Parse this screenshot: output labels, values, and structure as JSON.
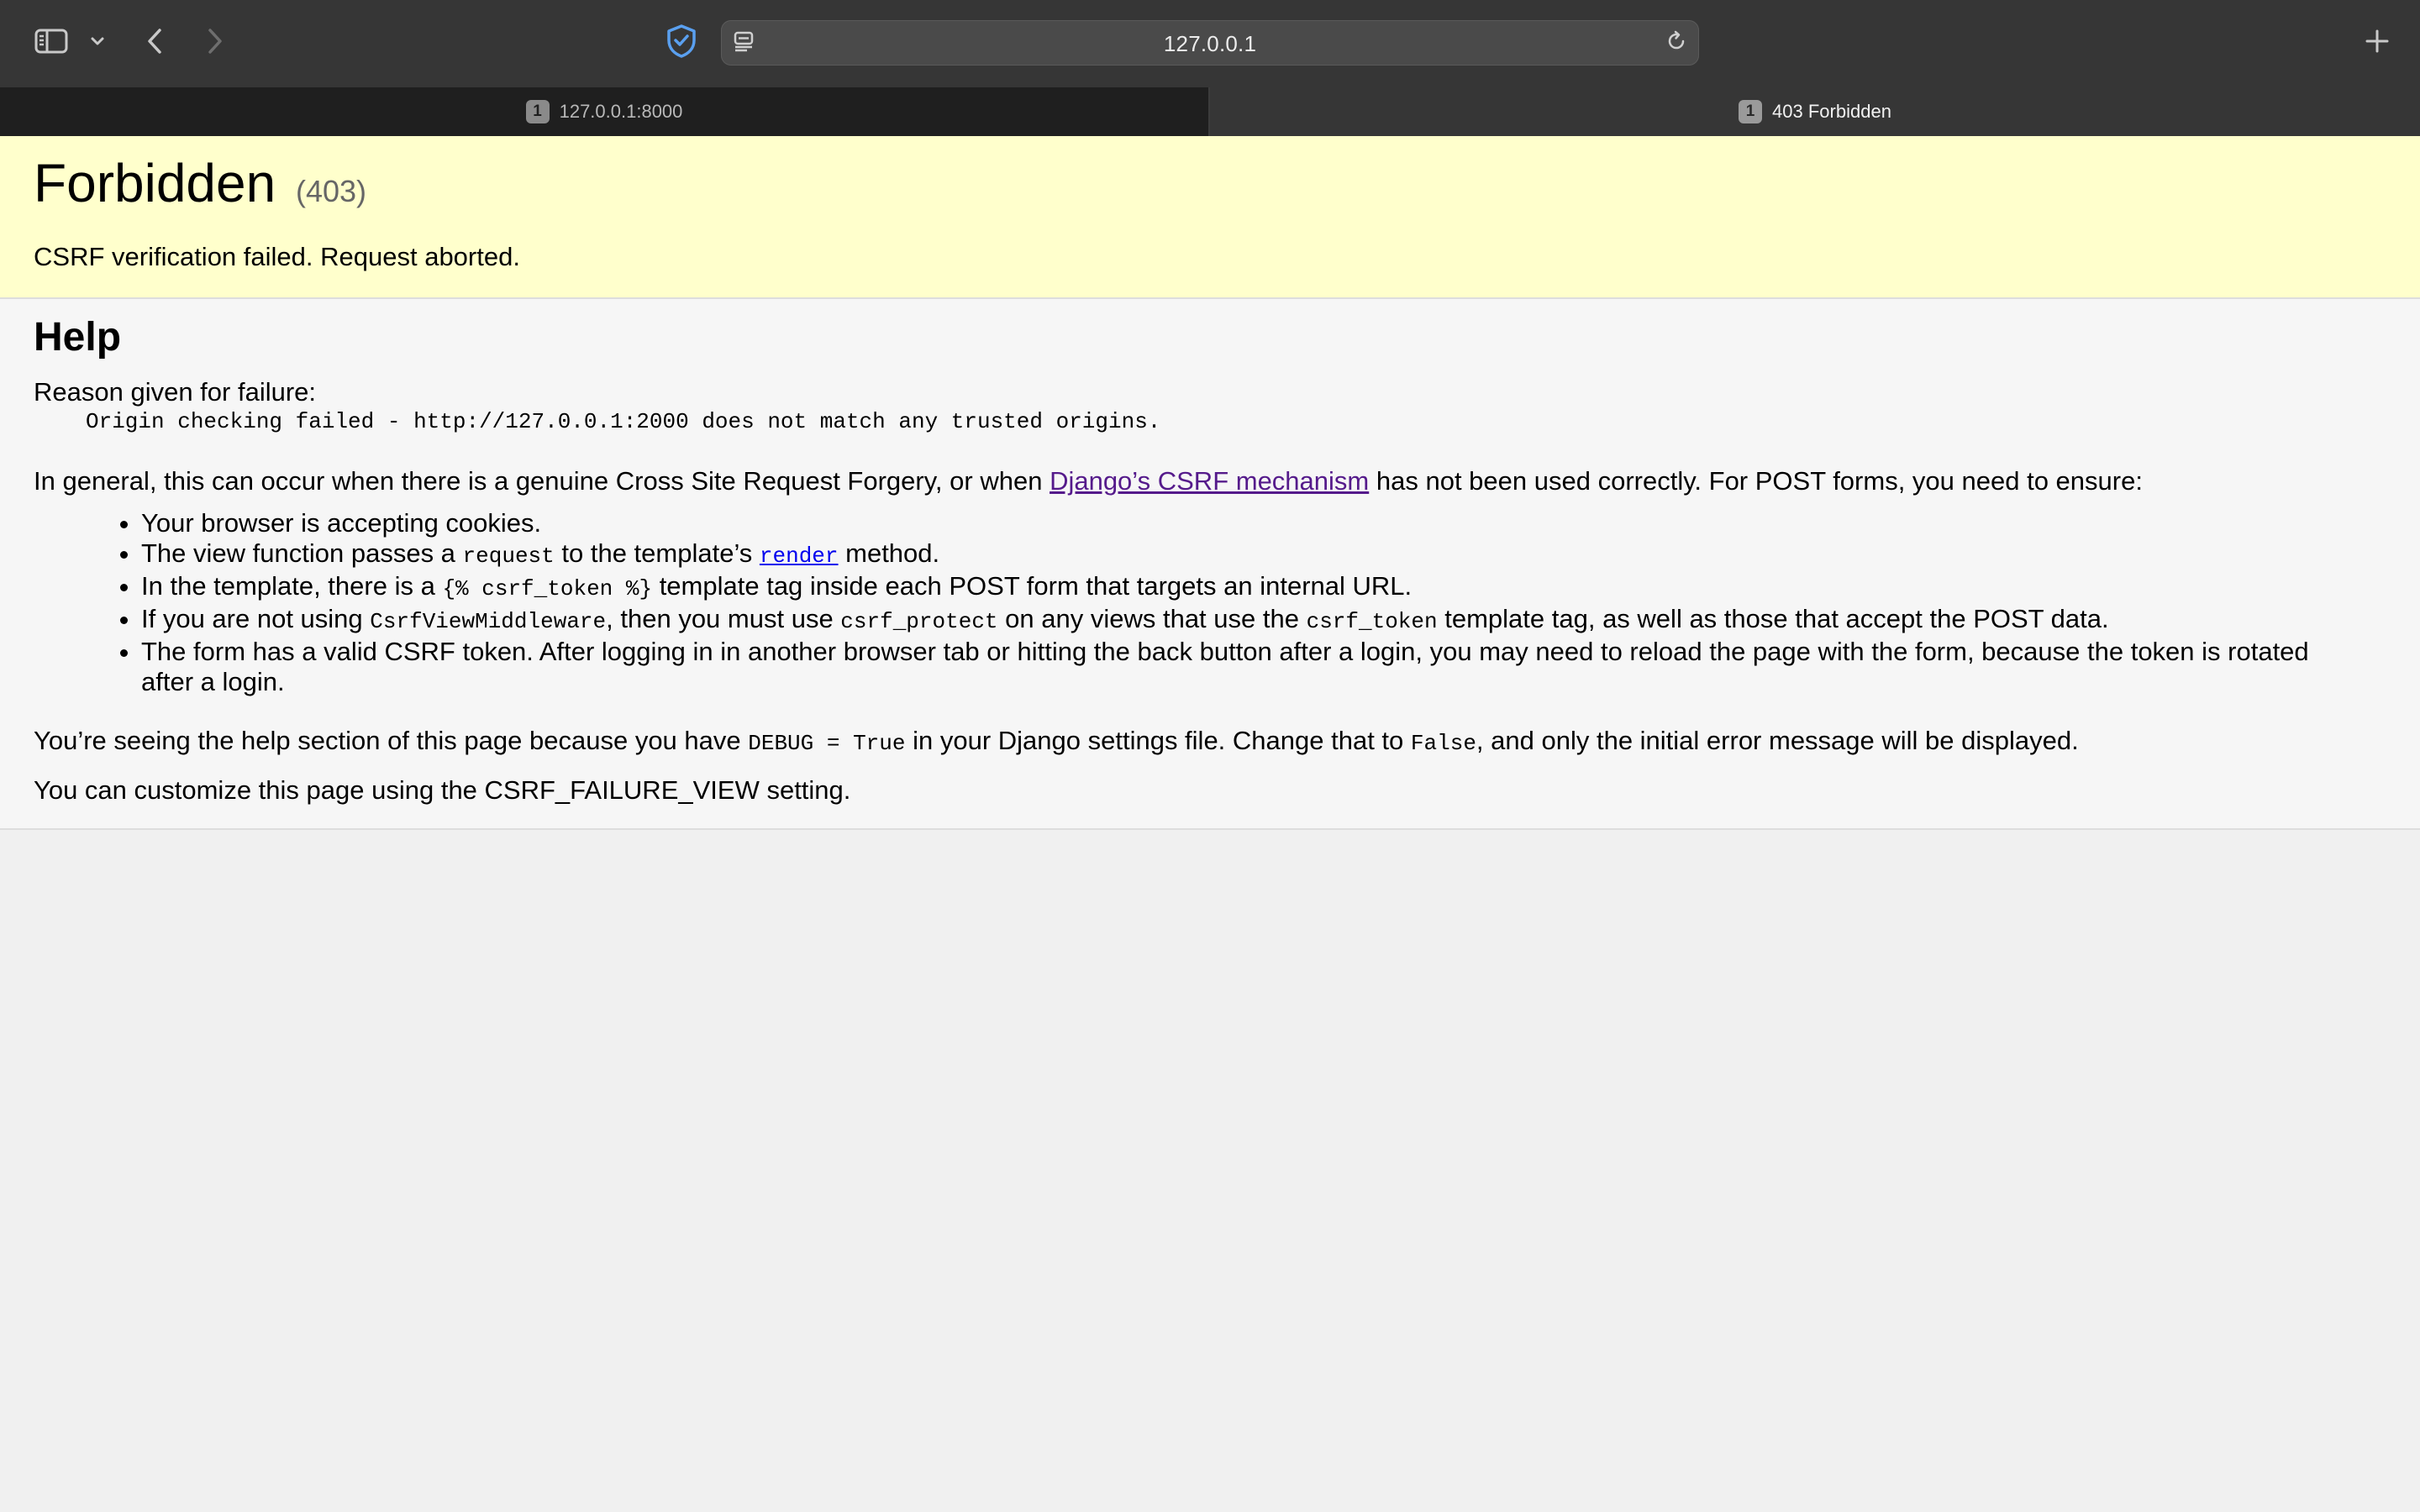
{
  "browser": {
    "address": "127.0.0.1",
    "tabs": [
      {
        "number": "1",
        "label": "127.0.0.1:8000",
        "active": false
      },
      {
        "number": "1",
        "label": "403 Forbidden",
        "active": true
      }
    ],
    "icons": [
      "sidebar-icon",
      "chevron-down-icon",
      "back-icon",
      "forward-icon",
      "shield-icon",
      "reader-icon",
      "reload-icon",
      "plus-icon"
    ]
  },
  "summary": {
    "title": "Forbidden",
    "code": "(403)",
    "message": "CSRF verification failed. Request aborted."
  },
  "help": {
    "title": "Help",
    "reason_label": "Reason given for failure:",
    "reason_detail": "Origin checking failed - http://127.0.0.1:2000 does not match any trusted origins.",
    "general": {
      "before": "In general, this can occur when there is a genuine Cross Site Request Forgery, or when ",
      "link": "Django’s CSRF mechanism",
      "after": " has not been used correctly. For POST forms, you need to ensure:"
    },
    "items": {
      "cookies": "Your browser is accepting cookies.",
      "render": {
        "t1": "The view function passes a ",
        "c1": "request",
        "t2": " to the template’s ",
        "link": "render",
        "t3": " method."
      },
      "token_tag": {
        "t1": "In the template, there is a ",
        "c1": "{% csrf_token %}",
        "t2": " template tag inside each POST form that targets an internal URL."
      },
      "middleware": {
        "t1": "If you are not using ",
        "c1": "CsrfViewMiddleware",
        "t2": ", then you must use ",
        "c2": "csrf_protect",
        "t3": " on any views that use the ",
        "c3": "csrf_token",
        "t4": " template tag, as well as those that accept the POST data."
      },
      "valid_token": "The form has a valid CSRF token. After logging in in another browser tab or hitting the back button after a login, you may need to reload the page with the form, because the token is rotated after a login."
    },
    "debug": {
      "t1": "You’re seeing the help section of this page because you have ",
      "c1": "DEBUG = True",
      "t2": " in your Django settings file. Change that to ",
      "c2": "False",
      "t3": ", and only the initial error message will be displayed."
    },
    "customize": "You can customize this page using the CSRF_FAILURE_VIEW setting."
  }
}
